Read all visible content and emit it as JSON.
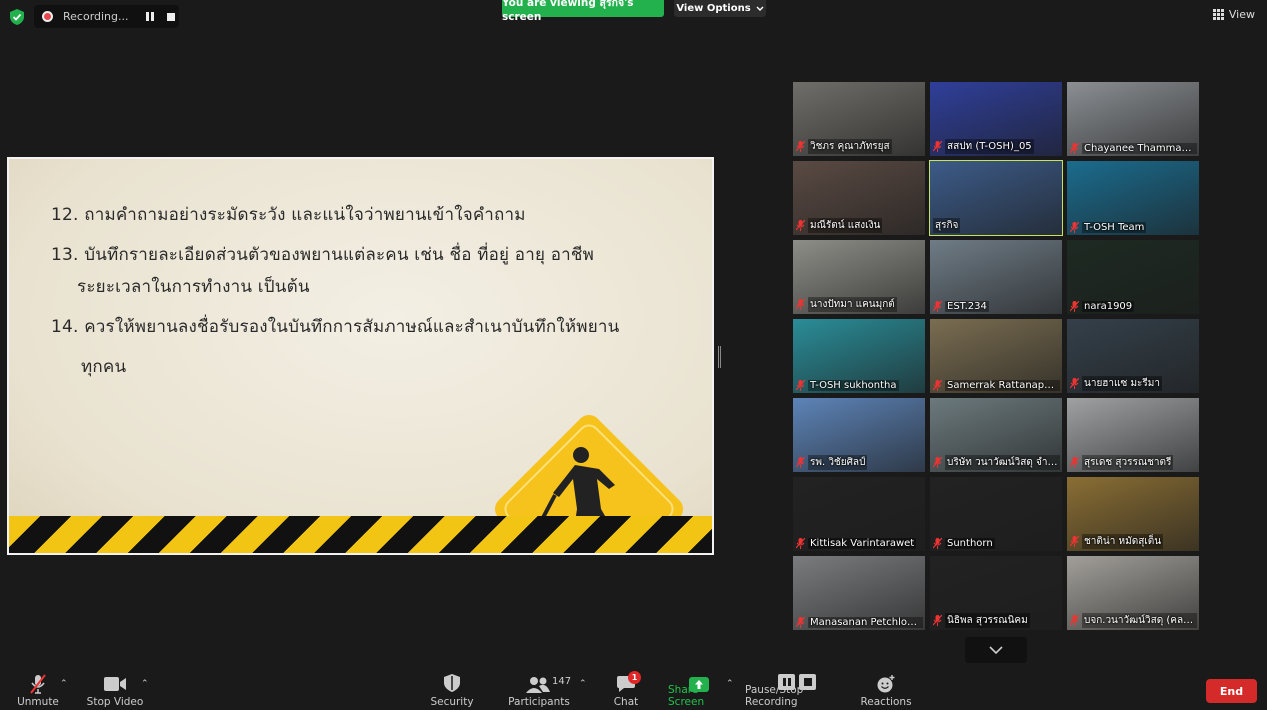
{
  "top_bar": {
    "recording_label": "Recording...",
    "viewing_banner": "You are viewing สุรกิจ's screen",
    "view_options_label": "View Options",
    "view_label": "View"
  },
  "slide": {
    "lines": [
      "12. ถามคำถามอย่างระมัดระวัง และแน่ใจว่าพยานเข้าใจคำถาม",
      "13. บันทึกรายละเอียดส่วนตัวของพยานแต่ละคน เช่น ชื่อ ที่อยู่ อายุ อาชีพ",
      "ระยะเวลาในการทำงาน เป็นต้น",
      "14. ควรให้พยานลงชื่อรับรองในบันทึกการสัมภาษณ์และสำเนาบันทึกให้พยาน",
      "ทุกคน"
    ]
  },
  "participants": [
    {
      "name": "วิชภร คุณาภัทรยุส",
      "bg": "#6f6e69"
    },
    {
      "name": "สสปท (T-OSH)_05",
      "bg": "#2f3f9a"
    },
    {
      "name": "Chayanee Thammarat ...",
      "bg": "#8b8f93"
    },
    {
      "name": "มณีรัตน์ แสงเงิน",
      "bg": "#5a4a43"
    },
    {
      "name": "สุรกิจ",
      "bg": "#3c5b88"
    },
    {
      "name": "T-OSH Team",
      "bg": "#1b6c8e"
    },
    {
      "name": "นางปัทมา แคนมุกต์",
      "bg": "#8e8e88"
    },
    {
      "name": "EST.234",
      "bg": "#6f7c86"
    },
    {
      "name": "nara1909",
      "bg": "#1d2a22"
    },
    {
      "name": "T-OSH sukhontha",
      "bg": "#2a8d98"
    },
    {
      "name": "Samerrak Rattanaphan",
      "bg": "#7a6d51"
    },
    {
      "name": "นายฮาแซ มะรีมา",
      "bg": "#34404a"
    },
    {
      "name": "รพ. วิชัยศิลป์",
      "bg": "#5d84b8"
    },
    {
      "name": "บริษัท วนาวัฒน์วิสดุ จำกัด",
      "bg": "#6c7a7d"
    },
    {
      "name": "สุรเดช สุวรรณชาตรี",
      "bg": "#9fa1a3"
    },
    {
      "name": "Kittisak Varintarawet",
      "bg": "#222222"
    },
    {
      "name": "Sunthorn",
      "bg": "#222222"
    },
    {
      "name": "ชาติน่า หมัดสุเต็น",
      "bg": "#8a6e34"
    },
    {
      "name": "Manasanan Petchloogin",
      "bg": "#7b7c7e"
    },
    {
      "name": "นิธิพล สุวรรณนิคม",
      "bg": "#222222"
    },
    {
      "name": "บจก.วนาวัฒน์วิสดุ (คลองแ...",
      "bg": "#a29f9a"
    }
  ],
  "toolbar": {
    "unmute": "Unmute",
    "stop_video": "Stop Video",
    "security": "Security",
    "participants": "Participants",
    "participants_count": "147",
    "chat": "Chat",
    "chat_badge": "1",
    "share_screen": "Share Screen",
    "pause_recording": "Pause/Stop Recording",
    "reactions": "Reactions",
    "end": "End"
  }
}
